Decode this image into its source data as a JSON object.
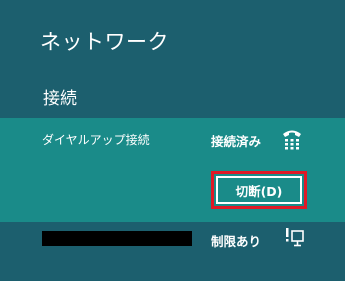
{
  "panel": {
    "title": "ネットワーク",
    "section_label": "接続"
  },
  "connections": [
    {
      "name": "ダイヤルアップ接続",
      "status": "接続済み",
      "icon": "dialup-phone-icon",
      "button_label": "切断(D)"
    },
    {
      "name": "",
      "status": "制限あり",
      "icon": "network-limited-icon"
    }
  ],
  "colors": {
    "background": "#1c5f6e",
    "selected_row": "#1a8b89",
    "highlight_border": "#e01826",
    "text": "#ffffff"
  }
}
